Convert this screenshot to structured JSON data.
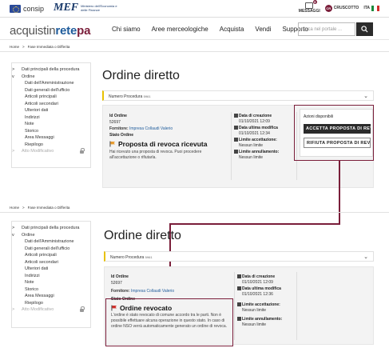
{
  "topbar": {
    "consip_label": "consip",
    "mef_mark": "MEF",
    "mef_sub": "Ministero dell'Economia e delle Finanze",
    "messaggi_label": "MESSAGGI",
    "messaggi_badge": "5",
    "cruscotto_label": "CRUSCOTTO",
    "cruscotto_icon": "CR",
    "lang_label": "ITA"
  },
  "header": {
    "brand_parts": [
      "acquistin",
      "rete",
      "pa"
    ],
    "nav": [
      "Chi siamo",
      "Aree merceologiche",
      "Acquista",
      "Vendi",
      "Supporto"
    ],
    "search_placeholder": "cerca nel portale ..."
  },
  "panels": [
    {
      "breadcrumb": [
        "Home",
        ">",
        "Fase Immediata o Differita"
      ],
      "sidebar": {
        "items": [
          {
            "label": "Dati principali della procedura",
            "caret": ">",
            "level": 0
          },
          {
            "label": "Ordine",
            "caret": "v",
            "level": 0
          },
          {
            "label": "Dati dell'Amministrazione",
            "level": 1
          },
          {
            "label": "Dati generali dell'ufficio",
            "level": 1
          },
          {
            "label": "Articoli principali",
            "level": 1
          },
          {
            "label": "Articoli secondari",
            "level": 1
          },
          {
            "label": "Ulteriori dati",
            "level": 1
          },
          {
            "label": "Indirizzi",
            "level": 1
          },
          {
            "label": "Note",
            "level": 1
          },
          {
            "label": "Storico",
            "level": 1
          },
          {
            "label": "Area Messaggi",
            "level": 1
          },
          {
            "label": "Riepilogo",
            "level": 1
          },
          {
            "label": "Atto Modificativo",
            "caret": ">",
            "level": 0,
            "disabled": true
          }
        ]
      },
      "title": "Ordine diretto",
      "procedure_label": "Numero Procedura",
      "procedure_number": "5961",
      "order": {
        "id_label": "Id Ordine",
        "id_value": "52697",
        "supplier_label": "Fornitore:",
        "supplier_value": "Impresa Collaudi Valerio",
        "state_label": "Stato Ordine",
        "status_title": "Proposta di revoca ricevuta",
        "status_desc": "Hai ricevuto una proposta di revoca. Puoi procedere all'accettazione o rifiutarla."
      },
      "dates": {
        "created_label": "Data di creazione",
        "created_value": "01/10/2021 12:09",
        "modified_label": "Data ultima modifica",
        "modified_value": "01/10/2021 12:34",
        "accept_label": "Limite accettazione:",
        "accept_value": "Nessun limite",
        "cancel_label": "Limite annullamento:",
        "cancel_value": "Nessun limite"
      },
      "actions": {
        "title": "Azioni disponibili",
        "accept_button": "ACCETTA PROPOSTA DI REVOCA",
        "reject_button": "RIFIUTA PROPOSTA DI REVOCA"
      }
    },
    {
      "breadcrumb": [
        "Home",
        ">",
        "Fase Immediata o Differita"
      ],
      "title": "Ordine diretto",
      "procedure_label": "Numero Procedura",
      "procedure_number": "5961",
      "order": {
        "id_label": "Id Ordine",
        "id_value": "52697",
        "supplier_label": "Fornitore:",
        "supplier_value": "Impresa Collaudi Valerio",
        "state_label": "Stato Ordine",
        "status_title": "Ordine revocato",
        "status_desc": "L'ordine è stato revocato di comune accordo tra le parti. Non è possibile effettuare alcuna operazione in questo stato. In caso di ordine NSO verrà automaticamente generato un ordine di revoca."
      },
      "dates": {
        "created_label": "Data di creazione",
        "created_value": "01/10/2021 12:09",
        "modified_label": "Data ultima modifica",
        "modified_value": "01/10/2021 12:36",
        "accept_label": "Limite accettazione:",
        "accept_value": "Nessun limite",
        "cancel_label": "Limite annullamento:",
        "cancel_value": "Nessun limite"
      }
    }
  ],
  "colors": {
    "brand_accent": "#7a1e3a",
    "brand_blue": "#1f5c9c",
    "status_flag_orange": "#e89b2e",
    "status_flag_red": "#d0312d"
  }
}
